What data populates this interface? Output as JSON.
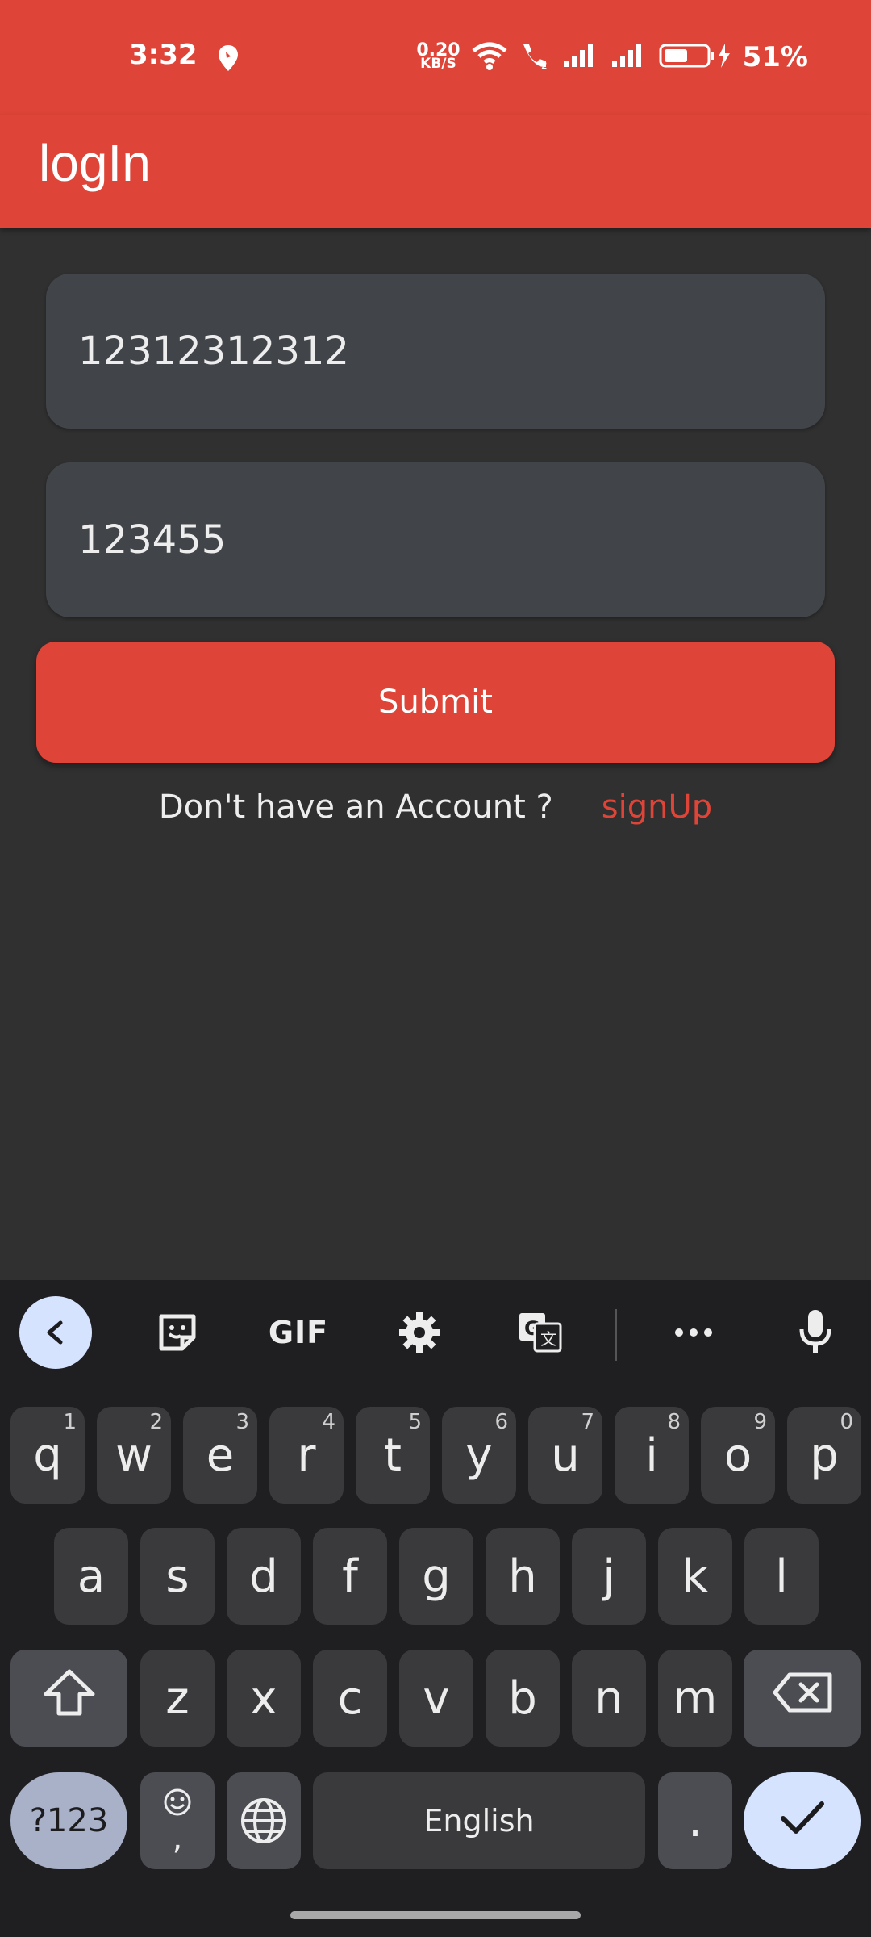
{
  "status_bar": {
    "time": "3:32",
    "net_speed_value": "0.20",
    "net_speed_unit": "KB/S",
    "battery_percent": "51%"
  },
  "app_bar": {
    "title": "logIn"
  },
  "form": {
    "phone_value": "12312312312",
    "password_value": "123455",
    "submit_label": "Submit",
    "signup_prompt": "Don't have an Account ?",
    "signup_link": "signUp"
  },
  "keyboard": {
    "toolbar": {
      "back_icon": "chevron-left-icon",
      "sticker_icon": "sticker-icon",
      "gif_label": "GIF",
      "settings_icon": "gear-icon",
      "translate_icon": "translate-icon",
      "more_icon": "more-dots-icon",
      "mic_icon": "microphone-icon"
    },
    "row1": [
      {
        "k": "q",
        "h": "1"
      },
      {
        "k": "w",
        "h": "2"
      },
      {
        "k": "e",
        "h": "3"
      },
      {
        "k": "r",
        "h": "4"
      },
      {
        "k": "t",
        "h": "5"
      },
      {
        "k": "y",
        "h": "6"
      },
      {
        "k": "u",
        "h": "7"
      },
      {
        "k": "i",
        "h": "8"
      },
      {
        "k": "o",
        "h": "9"
      },
      {
        "k": "p",
        "h": "0"
      }
    ],
    "row2": [
      "a",
      "s",
      "d",
      "f",
      "g",
      "h",
      "j",
      "k",
      "l"
    ],
    "row3": [
      "z",
      "x",
      "c",
      "v",
      "b",
      "n",
      "m"
    ],
    "num_label": "?123",
    "comma_label": ",",
    "space_label": "English",
    "period_label": "."
  },
  "colors": {
    "accent": "#DE4437",
    "background": "#303030",
    "field_bg": "#414549",
    "keyboard_bg": "#1F1F21"
  }
}
